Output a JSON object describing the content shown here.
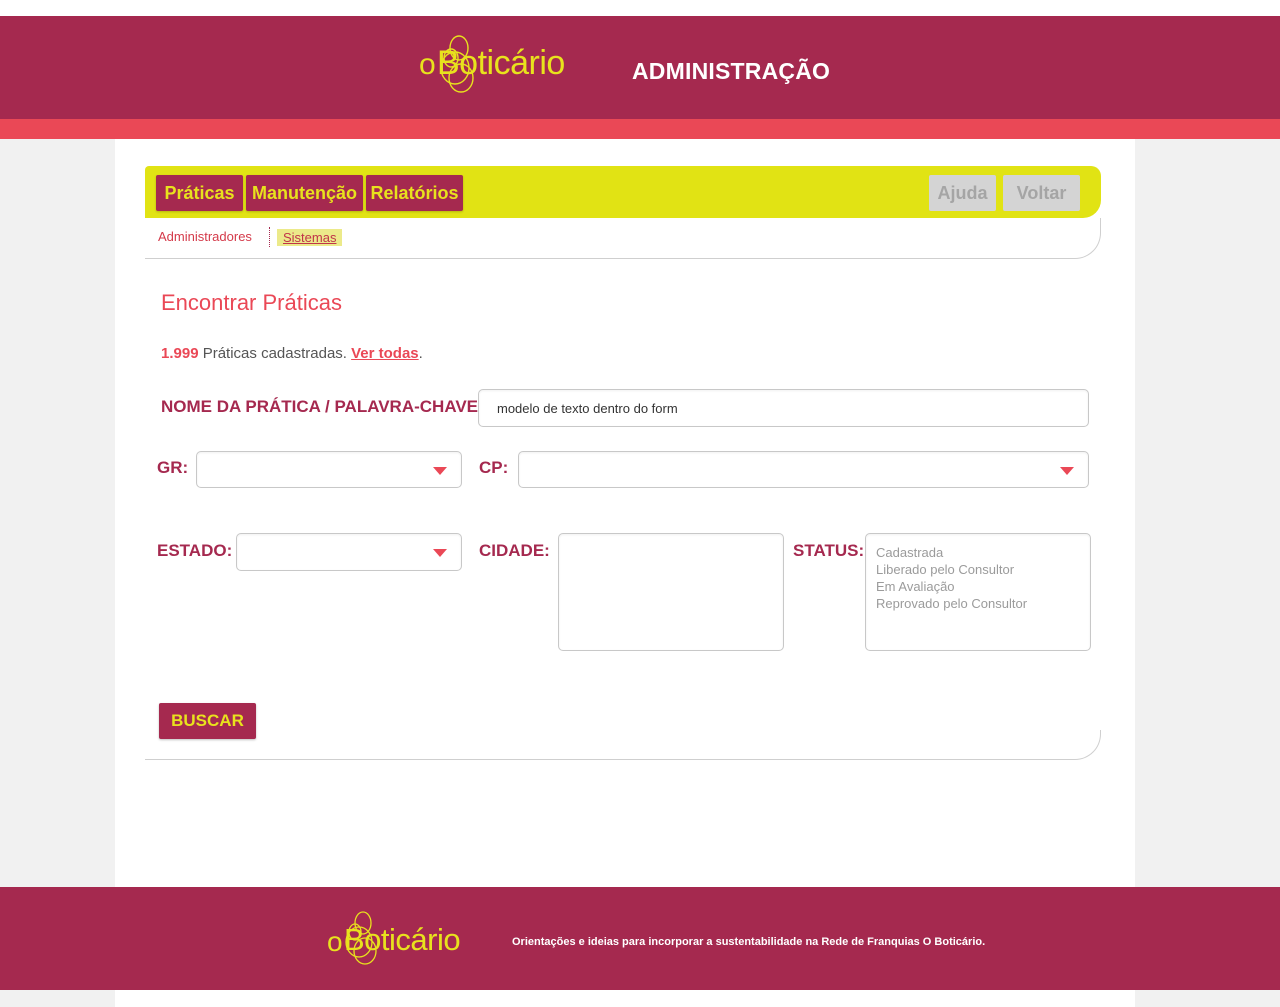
{
  "brand": {
    "logo_o": "o",
    "logo_name": "Boticário"
  },
  "header": {
    "title": "ADMINISTRAÇÃO"
  },
  "colors": {
    "primary": "#a5294f",
    "accent": "#ea4856",
    "yellow": "#e1e314",
    "logo_yellow": "#e8e21d"
  },
  "nav": {
    "items": [
      {
        "label": "Práticas"
      },
      {
        "label": "Manutenção"
      },
      {
        "label": "Relatórios"
      }
    ],
    "help_label": "Ajuda",
    "back_label": "Voltar"
  },
  "subnav": {
    "items": [
      {
        "label": "Administradores"
      },
      {
        "label": "Sistemas"
      }
    ]
  },
  "main": {
    "title": "Encontrar Práticas",
    "count_value": "1.999",
    "count_text": " Práticas cadastradas. ",
    "view_all": "Ver todas",
    "period": "."
  },
  "form": {
    "keyword_label": "NOME DA PRÁTICA / PALAVRA-CHAVE:",
    "keyword_value": "modelo de texto dentro do form",
    "gr_label": "GR:",
    "cp_label": "CP:",
    "estado_label": "ESTADO:",
    "cidade_label": "CIDADE:",
    "status_label": "STATUS:",
    "status_options": [
      "Cadastrada",
      "Liberado pelo Consultor",
      "Em Avaliação",
      "Reprovado pelo Consultor"
    ],
    "search_button": "BUSCAR"
  },
  "footer": {
    "text": "Orientações e ideias para incorporar a sustentabilidade na Rede de Franquias O Boticário."
  }
}
